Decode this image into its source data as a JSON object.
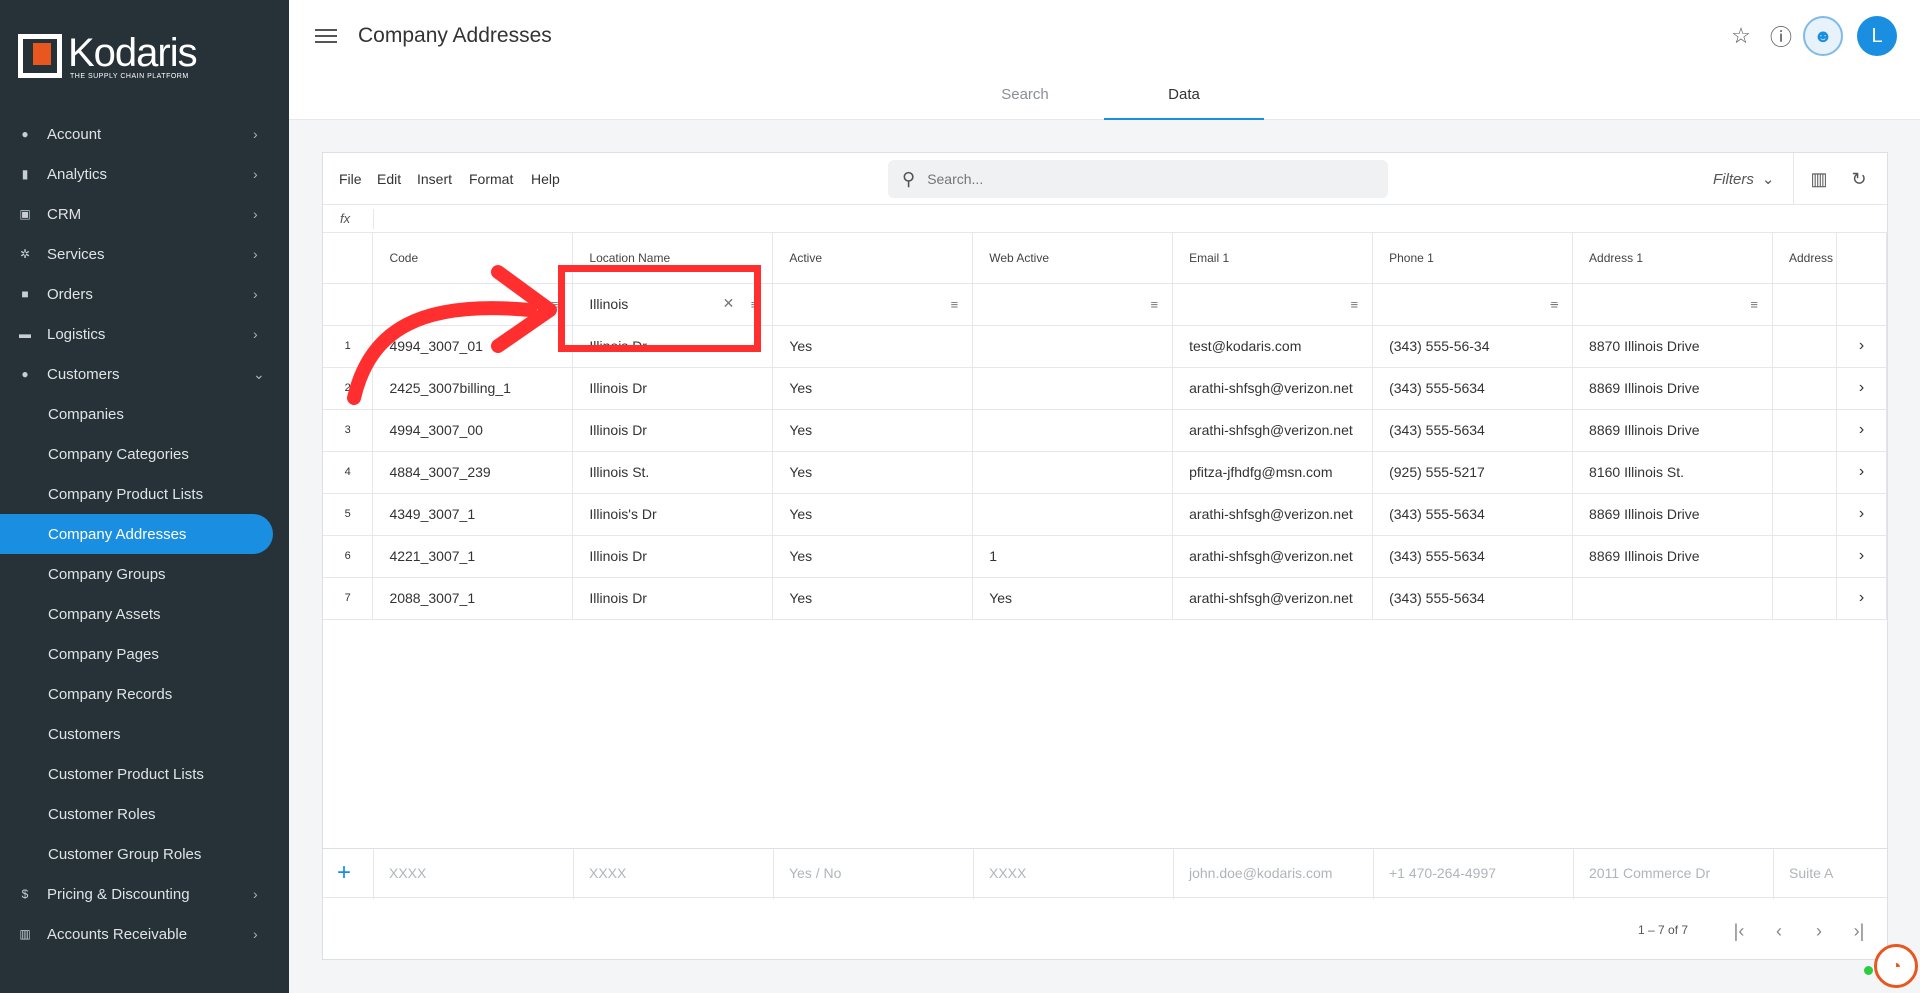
{
  "app": {
    "logo_name": "Kodaris",
    "logo_tagline": "THE SUPPLY CHAIN PLATFORM"
  },
  "header": {
    "title": "Company Addresses",
    "avatar_letter": "L",
    "tabs": [
      {
        "label": "Search"
      },
      {
        "label": "Data"
      }
    ]
  },
  "sidebar": {
    "items": [
      {
        "label": "Account",
        "icon": "person-icon"
      },
      {
        "label": "Analytics",
        "icon": "chart-icon"
      },
      {
        "label": "CRM",
        "icon": "contact-card-icon"
      },
      {
        "label": "Services",
        "icon": "gears-icon"
      },
      {
        "label": "Orders",
        "icon": "truck-icon"
      },
      {
        "label": "Logistics",
        "icon": "shipping-icon"
      },
      {
        "label": "Customers",
        "icon": "people-icon"
      }
    ],
    "subitems": [
      "Companies",
      "Company Categories",
      "Company Product Lists",
      "Company Addresses",
      "Company Groups",
      "Company Assets",
      "Company Pages",
      "Company Records",
      "Customers",
      "Customer Product Lists",
      "Customer Roles",
      "Customer Group Roles"
    ],
    "bottom_items": [
      {
        "label": "Pricing & Discounting",
        "icon": "dollar-icon"
      },
      {
        "label": "Accounts Receivable",
        "icon": "bank-icon"
      }
    ]
  },
  "toolbar": {
    "menus": [
      "File",
      "Edit",
      "Insert",
      "Format",
      "Help"
    ],
    "search_placeholder": "Search...",
    "filters_label": "Filters"
  },
  "grid": {
    "fx_label": "fx",
    "columns": [
      "Code",
      "Location Name",
      "Active",
      "Web Active",
      "Email 1",
      "Phone 1",
      "Address 1",
      "Address"
    ],
    "filter_value": "Illinois",
    "rows": [
      {
        "n": "1",
        "code": "4994_3007_01",
        "name": "Illinois Dr",
        "active": "Yes",
        "web": "",
        "email": "test@kodaris.com",
        "phone": "(343) 555-56-34",
        "addr": "8870 Illinois Drive"
      },
      {
        "n": "2",
        "code": "2425_3007billing_1",
        "name": "Illinois Dr",
        "active": "Yes",
        "web": "",
        "email": "arathi-shfsgh@verizon.net",
        "phone": "(343) 555-5634",
        "addr": "8869 Illinois Drive"
      },
      {
        "n": "3",
        "code": "4994_3007_00",
        "name": "Illinois Dr",
        "active": "Yes",
        "web": "",
        "email": "arathi-shfsgh@verizon.net",
        "phone": "(343) 555-5634",
        "addr": "8869 Illinois Drive"
      },
      {
        "n": "4",
        "code": "4884_3007_239",
        "name": "Illinois St.",
        "active": "Yes",
        "web": "",
        "email": "pfitza-jfhdfg@msn.com",
        "phone": "(925) 555-5217",
        "addr": "8160 Illinois St."
      },
      {
        "n": "5",
        "code": "4349_3007_1",
        "name": "Illinois's Dr",
        "active": "Yes",
        "web": "",
        "email": "arathi-shfsgh@verizon.net",
        "phone": "(343) 555-5634",
        "addr": "8869 Illinois Drive"
      },
      {
        "n": "6",
        "code": "4221_3007_1",
        "name": "Illinois Dr",
        "active": "Yes",
        "web": "1",
        "email": "arathi-shfsgh@verizon.net",
        "phone": "(343) 555-5634",
        "addr": "8869 Illinois Drive"
      },
      {
        "n": "7",
        "code": "2088_3007_1",
        "name": "Illinois Dr",
        "active": "Yes",
        "web": "Yes",
        "email": "arathi-shfsgh@verizon.net",
        "phone": "(343) 555-5634",
        "addr": ""
      }
    ],
    "new_row_placeholders": [
      "XXXX",
      "XXXX",
      "Yes / No",
      "XXXX",
      "john.doe@kodaris.com",
      "+1 470-264-4997",
      "2011 Commerce Dr",
      "Suite A"
    ],
    "pager_text": "1 – 7 of 7"
  },
  "colors": {
    "sidebar_bg": "#263238",
    "accent": "#1a8ee0",
    "annotation": "#ff2f2f",
    "brand_orange": "#e8571f"
  }
}
